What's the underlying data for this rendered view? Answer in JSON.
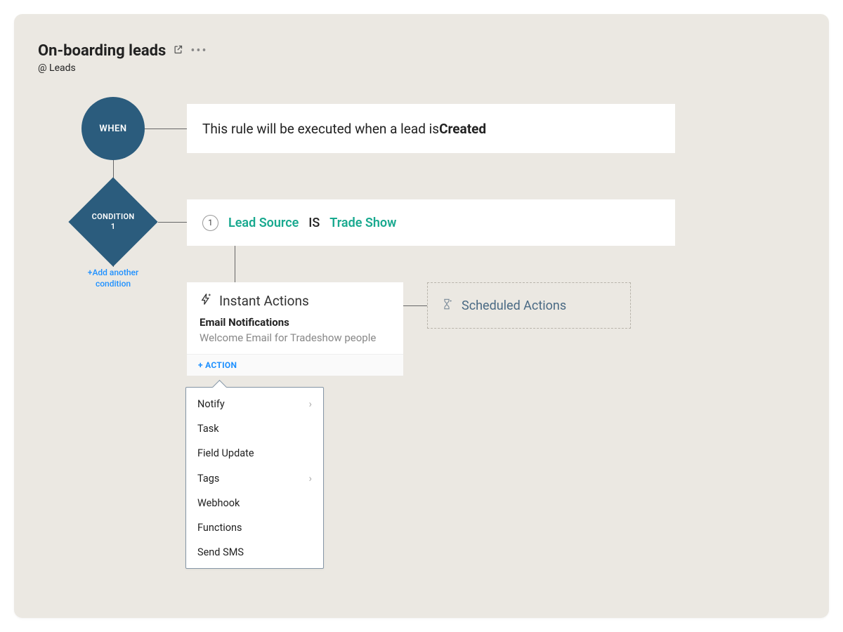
{
  "header": {
    "title": "On-boarding leads",
    "module": "@ Leads"
  },
  "when": {
    "node_label": "WHEN",
    "rule_text_prefix": "This rule will be executed when a lead is ",
    "rule_trigger": "Created"
  },
  "condition": {
    "node_label_line1": "CONDITION",
    "node_label_line2": "1",
    "add_another": "+Add another condition",
    "num": "1",
    "field": "Lead Source",
    "op": "IS",
    "value": "Trade Show"
  },
  "instant_actions": {
    "title": "Instant Actions",
    "email_notifications_label": "Email Notifications",
    "email_name": "Welcome Email for Tradeshow people",
    "add_action": "+ ACTION"
  },
  "scheduled_actions": {
    "title": "Scheduled Actions"
  },
  "action_menu": {
    "items": [
      {
        "label": "Notify",
        "has_submenu": true
      },
      {
        "label": "Task",
        "has_submenu": false
      },
      {
        "label": "Field Update",
        "has_submenu": false
      },
      {
        "label": "Tags",
        "has_submenu": true
      },
      {
        "label": "Webhook",
        "has_submenu": false
      },
      {
        "label": "Functions",
        "has_submenu": false
      },
      {
        "label": "Send SMS",
        "has_submenu": false
      }
    ]
  },
  "colors": {
    "node_blue": "#2b5c7d",
    "link_blue": "#1e90ff",
    "teal": "#19a98f",
    "bg": "#ebe8e2"
  }
}
